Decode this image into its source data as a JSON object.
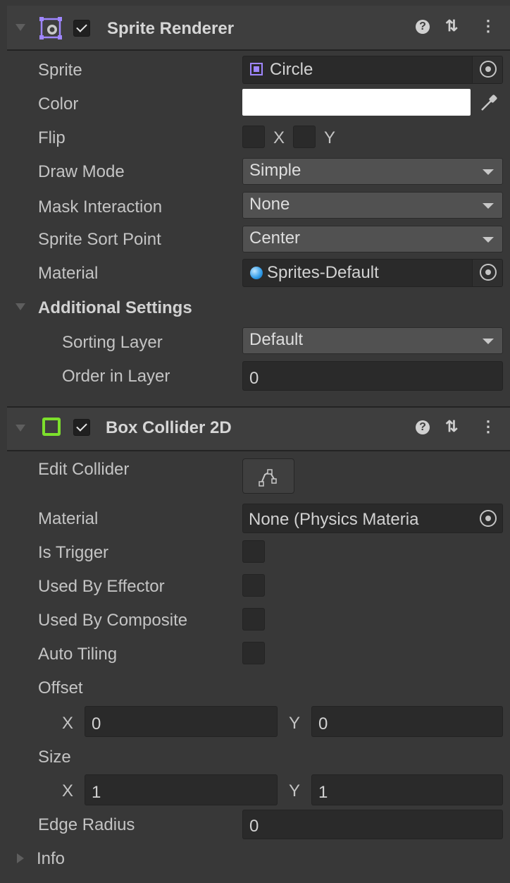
{
  "sprite_renderer": {
    "title": "Sprite Renderer",
    "help_icon": "?",
    "presets_icon": "⇅",
    "menu_icon": "⋮",
    "enabled": true,
    "fields": {
      "sprite_label": "Sprite",
      "sprite_value": "Circle",
      "color_label": "Color",
      "color_value": "#ffffff",
      "flip_label": "Flip",
      "flip_x": "X",
      "flip_y": "Y",
      "draw_mode_label": "Draw Mode",
      "draw_mode_value": "Simple",
      "mask_label": "Mask Interaction",
      "mask_value": "None",
      "sort_point_label": "Sprite Sort Point",
      "sort_point_value": "Center",
      "material_label": "Material",
      "material_value": "Sprites-Default"
    },
    "additional": {
      "title": "Additional Settings",
      "sorting_layer_label": "Sorting Layer",
      "sorting_layer_value": "Default",
      "order_label": "Order in Layer",
      "order_value": "0"
    }
  },
  "box_collider": {
    "title": "Box Collider 2D",
    "help_icon": "?",
    "presets_icon": "⇅",
    "menu_icon": "⋮",
    "enabled": true,
    "edit_collider_label": "Edit Collider",
    "material_label": "Material",
    "material_value": "None (Physics Materia",
    "is_trigger_label": "Is Trigger",
    "used_by_effector_label": "Used By Effector",
    "used_by_composite_label": "Used By Composite",
    "auto_tiling_label": "Auto Tiling",
    "offset_label": "Offset",
    "offset_x_label": "X",
    "offset_x": "0",
    "offset_y_label": "Y",
    "offset_y": "0",
    "size_label": "Size",
    "size_x_label": "X",
    "size_x": "1",
    "size_y_label": "Y",
    "size_y": "1",
    "edge_radius_label": "Edge Radius",
    "edge_radius_value": "0",
    "info_label": "Info"
  },
  "colors": {
    "panel": "#383838",
    "header": "#3e3e3e",
    "field": "#2a2a2a",
    "dropdown": "#515151",
    "collider_icon": "#7de02c",
    "sprite_icon": "#9f86ff"
  }
}
